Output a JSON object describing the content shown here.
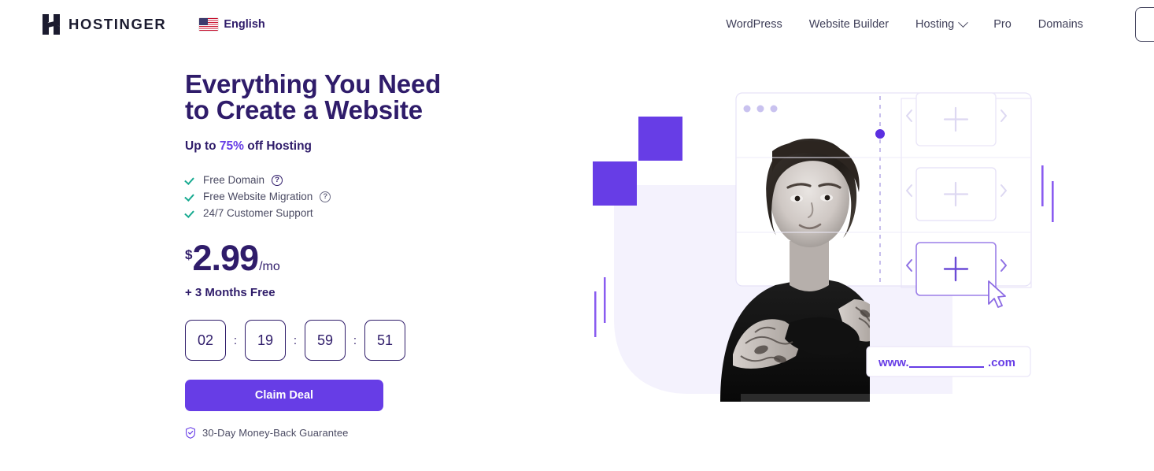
{
  "header": {
    "brand_name": "HOSTINGER",
    "logo_icon": "hostinger-h-logo",
    "language": {
      "label": "English",
      "flag_icon": "us-flag-icon"
    },
    "nav": [
      {
        "label": "WordPress",
        "has_dropdown": false
      },
      {
        "label": "Website Builder",
        "has_dropdown": false
      },
      {
        "label": "Hosting",
        "has_dropdown": true,
        "dropdown_icon": "chevron-down-icon"
      },
      {
        "label": "Pro",
        "has_dropdown": false
      },
      {
        "label": "Domains",
        "has_dropdown": false
      }
    ]
  },
  "hero": {
    "headline": "Everything You Need to Create a Website",
    "subhead_prefix": "Up to ",
    "subhead_percent": "75%",
    "subhead_suffix": " off Hosting",
    "features": [
      {
        "label": "Free Domain",
        "info_icon": "question-circle-icon",
        "has_info": true,
        "info_style": "dark"
      },
      {
        "label": "Free Website Migration",
        "info_icon": "question-circle-icon",
        "has_info": true,
        "info_style": "grey"
      },
      {
        "label": "24/7 Customer Support",
        "has_info": false
      }
    ],
    "price": {
      "currency": "$",
      "amount": "2.99",
      "period": "/mo"
    },
    "bonus": "+ 3 Months Free",
    "countdown": {
      "days": "02",
      "hours": "19",
      "minutes": "59",
      "seconds": "51",
      "separator": ":"
    },
    "cta_label": "Claim Deal",
    "guarantee": {
      "label": "30-Day Money-Back Guarantee",
      "icon": "shield-check-icon"
    }
  },
  "illustration": {
    "domain_bar": {
      "prefix": "www.",
      "blank": "",
      "suffix": ".com"
    },
    "cursor_icon": "mouse-cursor-icon",
    "card_icons": [
      "plus-icon",
      "plus-icon",
      "plus-icon"
    ],
    "arrow_icons": [
      "chevron-left-icon",
      "chevron-right-icon"
    ],
    "browser_dots": 3,
    "photo_alt": "woman-with-tattoos-portrait"
  },
  "colors": {
    "brand_purple": "#673de6",
    "deep_purple": "#2f1c6a",
    "text_grey": "#4b4b63",
    "green_check": "#18aa90",
    "lavender_bg": "#f4f2fd"
  }
}
